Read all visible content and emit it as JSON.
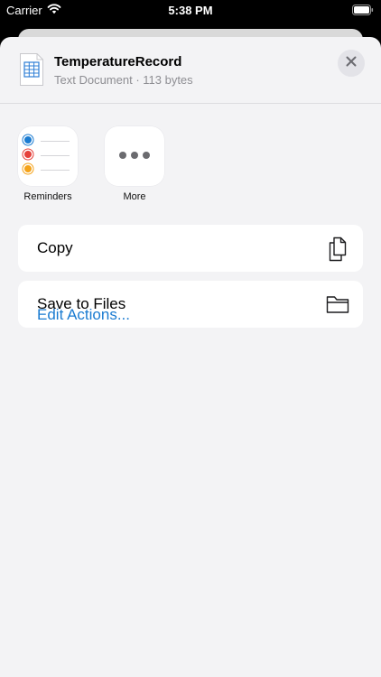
{
  "status_bar": {
    "carrier": "Carrier",
    "time": "5:38 PM"
  },
  "sheet": {
    "file_name": "TemperatureRecord",
    "file_meta": "Text Document · 113 bytes"
  },
  "apps": [
    {
      "label": "Reminders",
      "icon": "reminders-icon"
    },
    {
      "label": "More",
      "icon": "more-icon"
    }
  ],
  "actions": [
    {
      "label": "Copy",
      "icon": "copy-icon"
    },
    {
      "label": "Save to Files",
      "icon": "folder-icon"
    }
  ],
  "edit_actions_label": "Edit Actions...",
  "colors": {
    "accent": "#1a7bd1",
    "reminder_blue": "#1a7bd1",
    "reminder_red": "#e5413b",
    "reminder_orange": "#f4a31b"
  }
}
